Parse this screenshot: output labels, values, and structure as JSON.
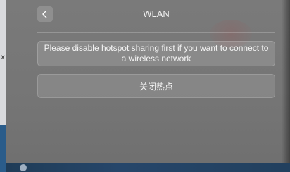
{
  "header": {
    "title": "WLAN",
    "back_icon": "chevron-left-icon"
  },
  "notice": {
    "message": "Please disable hotspot sharing first if you want to connect to a wireless network"
  },
  "actions": {
    "close_hotspot_label": "关闭热点"
  },
  "background": {
    "glyph": "x"
  },
  "colors": {
    "panel": "#757575",
    "text": "#f2f2f2",
    "taskbar": "#22405e"
  }
}
